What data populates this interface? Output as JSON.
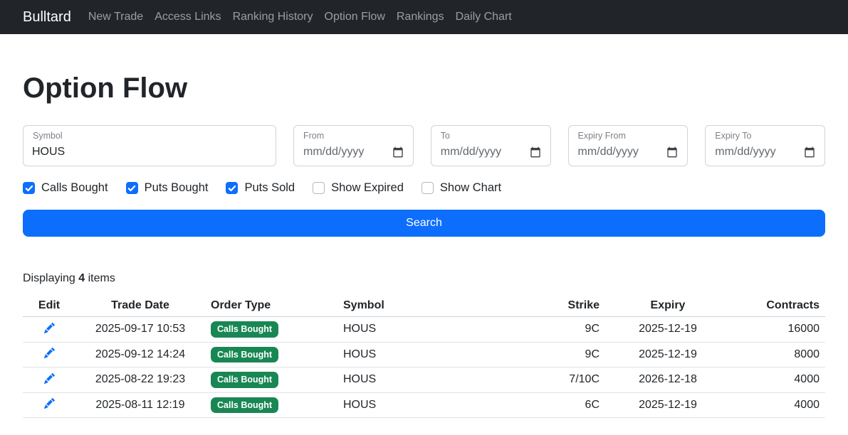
{
  "colors": {
    "primary": "#0d6efd",
    "success": "#198754",
    "navbar-bg": "#212529",
    "border": "#dee2e6"
  },
  "navbar": {
    "brand": "Bulltard",
    "items": [
      {
        "label": "New Trade"
      },
      {
        "label": "Access Links"
      },
      {
        "label": "Ranking History"
      },
      {
        "label": "Option Flow"
      },
      {
        "label": "Rankings"
      },
      {
        "label": "Daily Chart"
      }
    ]
  },
  "page": {
    "title": "Option Flow"
  },
  "filters": {
    "symbol": {
      "label": "Symbol",
      "value": "HOUS"
    },
    "from": {
      "label": "From",
      "placeholder": "mm/dd/yyyy"
    },
    "to": {
      "label": "To",
      "placeholder": "mm/dd/yyyy"
    },
    "expiry_from": {
      "label": "Expiry From",
      "placeholder": "mm/dd/yyyy"
    },
    "expiry_to": {
      "label": "Expiry To",
      "placeholder": "mm/dd/yyyy"
    }
  },
  "checkboxes": [
    {
      "label": "Calls Bought",
      "checked": true
    },
    {
      "label": "Puts Bought",
      "checked": true
    },
    {
      "label": "Puts Sold",
      "checked": true
    },
    {
      "label": "Show Expired",
      "checked": false
    },
    {
      "label": "Show Chart",
      "checked": false
    }
  ],
  "search": {
    "label": "Search"
  },
  "results": {
    "prefix": "Displaying",
    "count": "4",
    "suffix": "items"
  },
  "table": {
    "headers": [
      "Edit",
      "Trade Date",
      "Order Type",
      "Symbol",
      "Strike",
      "Expiry",
      "Contracts"
    ],
    "rows": [
      {
        "trade_date": "2025-09-17 10:53",
        "order_type": "Calls Bought",
        "symbol": "HOUS",
        "strike": "9C",
        "expiry": "2025-12-19",
        "contracts": "16000"
      },
      {
        "trade_date": "2025-09-12 14:24",
        "order_type": "Calls Bought",
        "symbol": "HOUS",
        "strike": "9C",
        "expiry": "2025-12-19",
        "contracts": "8000"
      },
      {
        "trade_date": "2025-08-22 19:23",
        "order_type": "Calls Bought",
        "symbol": "HOUS",
        "strike": "7/10C",
        "expiry": "2026-12-18",
        "contracts": "4000"
      },
      {
        "trade_date": "2025-08-11 12:19",
        "order_type": "Calls Bought",
        "symbol": "HOUS",
        "strike": "6C",
        "expiry": "2025-12-19",
        "contracts": "4000"
      }
    ]
  }
}
